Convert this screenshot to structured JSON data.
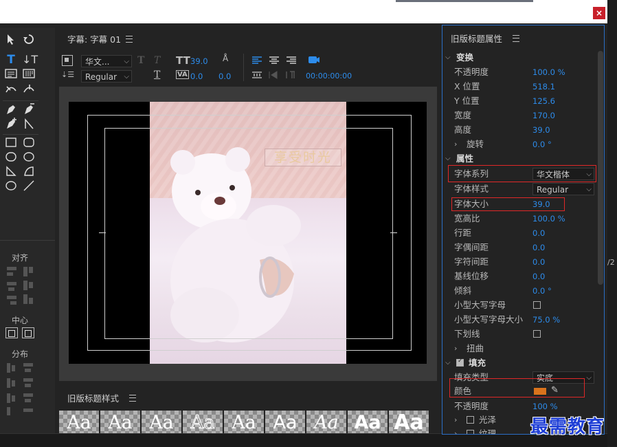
{
  "window": {
    "close_label": "×"
  },
  "tools": {
    "align_label": "对齐",
    "center_label": "中心",
    "distribute_label": "分布"
  },
  "main_panel": {
    "title": "字幕: 字幕 01",
    "font_family_value": "华文...",
    "font_style_value": "Regular",
    "font_size_value": "39.0",
    "kerning_value": "0.0",
    "leading_value": "0.0",
    "timecode": "00:00:00:00",
    "tool_text_icon_1": "T",
    "tool_text_icon_2": "T",
    "tool_text_icon_3": "T",
    "tool_size_icon": "TT",
    "tool_kerning_icon": "VA"
  },
  "canvas": {
    "title_text": "享受时光"
  },
  "styles_panel": {
    "title": "旧版标题样式",
    "swatches": [
      "Aa",
      "Aa",
      "Aa",
      "Aa",
      "Aa",
      "Aa",
      "Aa",
      "Aa",
      "Aa"
    ]
  },
  "properties": {
    "title": "旧版标题属性",
    "transform_label": "变换",
    "opacity_label": "不透明度",
    "opacity_value": "100.0 %",
    "xpos_label": "X 位置",
    "xpos_value": "518.1",
    "ypos_label": "Y 位置",
    "ypos_value": "125.6",
    "width_label": "宽度",
    "width_value": "170.0",
    "height_label": "高度",
    "height_value": "39.0",
    "rotation_label": "旋转",
    "rotation_value": "0.0 °",
    "attributes_label": "属性",
    "font_family_label": "字体系列",
    "font_family_value": "华文楷体",
    "font_style_label": "字体样式",
    "font_style_value": "Regular",
    "font_size_label": "字体大小",
    "font_size_value": "39.0",
    "aspect_label": "宽高比",
    "aspect_value": "100.0 %",
    "leading_label": "行距",
    "leading_value": "0.0",
    "kerning_label": "字偶间距",
    "kerning_value": "0.0",
    "tracking_label": "字符间距",
    "tracking_value": "0.0",
    "baseline_label": "基线位移",
    "baseline_value": "0.0",
    "slant_label": "倾斜",
    "slant_value": "0.0 °",
    "smallcaps_label": "小型大写字母",
    "smallcaps_size_label": "小型大写字母大小",
    "smallcaps_size_value": "75.0 %",
    "underline_label": "下划线",
    "distort_label": "扭曲",
    "fill_label": "填充",
    "fill_type_label": "填充类型",
    "fill_type_value": "实底",
    "color_label": "颜色",
    "color_value": "#d9731c",
    "fill_opacity_label": "不透明度",
    "fill_opacity_value": "100 %",
    "sheen_label": "光泽",
    "texture_label": "纹理"
  },
  "side_fragment": "/2",
  "watermark": "最需教育"
}
